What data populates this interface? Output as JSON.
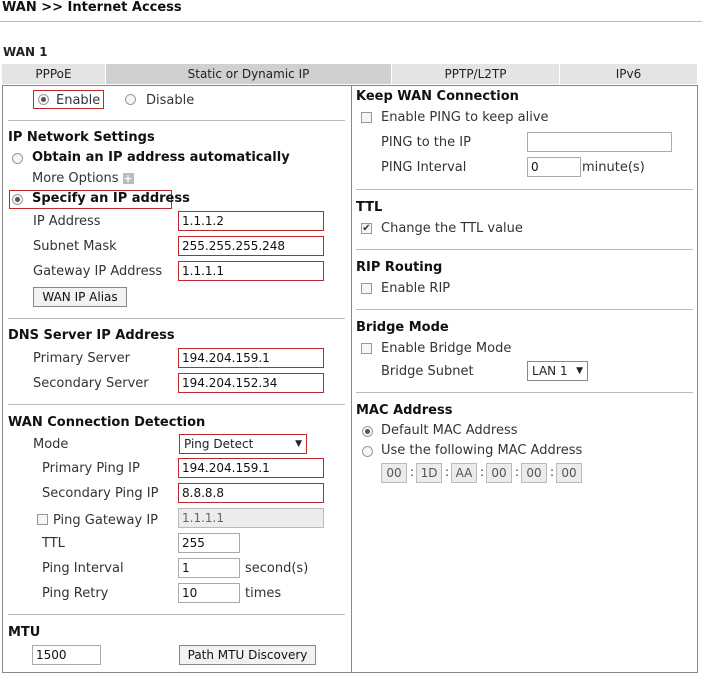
{
  "breadcrumb": "WAN >> Internet Access",
  "wan_title": "WAN 1",
  "tabs": [
    "PPPoE",
    "Static or Dynamic IP",
    "PPTP/L2TP",
    "IPv6"
  ],
  "enable": {
    "enable_label": "Enable",
    "disable_label": "Disable"
  },
  "ip_settings": {
    "title": "IP Network Settings",
    "obtain_auto": "Obtain an IP address automatically",
    "more_options": "More Options",
    "specify": "Specify an IP address",
    "ip_label": "IP Address",
    "ip_value": "1.1.1.2",
    "mask_label": "Subnet Mask",
    "mask_value": "255.255.255.248",
    "gw_label": "Gateway IP Address",
    "gw_value": "1.1.1.1",
    "alias_button": "WAN IP Alias"
  },
  "dns": {
    "title": "DNS Server IP Address",
    "primary_label": "Primary Server",
    "primary_value": "194.204.159.1",
    "secondary_label": "Secondary Server",
    "secondary_value": "194.204.152.34"
  },
  "detection": {
    "title": "WAN Connection Detection",
    "mode_label": "Mode",
    "mode_value": "Ping Detect",
    "primary_ping_label": "Primary Ping IP",
    "primary_ping_value": "194.204.159.1",
    "secondary_ping_label": "Secondary Ping IP",
    "secondary_ping_value": "8.8.8.8",
    "ping_gw_label": "Ping Gateway IP",
    "ping_gw_value": "1.1.1.1",
    "ttl_label": "TTL",
    "ttl_value": "255",
    "interval_label": "Ping Interval",
    "interval_value": "1",
    "interval_unit": "second(s)",
    "retry_label": "Ping Retry",
    "retry_value": "10",
    "retry_unit": "times"
  },
  "mtu": {
    "title": "MTU",
    "value": "1500",
    "discovery_button": "Path MTU Discovery"
  },
  "keep": {
    "title": "Keep WAN Connection",
    "enable_ping": "Enable PING to keep alive",
    "ping_ip_label": "PING to the IP",
    "ping_ip_value": "",
    "interval_label": "PING Interval",
    "interval_value": "0",
    "interval_unit": "minute(s)"
  },
  "ttl": {
    "title": "TTL",
    "change": "Change the TTL value"
  },
  "rip": {
    "title": "RIP Routing",
    "enable": "Enable RIP"
  },
  "bridge": {
    "title": "Bridge Mode",
    "enable": "Enable Bridge Mode",
    "subnet_label": "Bridge Subnet",
    "subnet_value": "LAN 1"
  },
  "mac": {
    "title": "MAC Address",
    "default": "Default MAC Address",
    "use_following": "Use the following MAC Address",
    "octets": [
      "00",
      "1D",
      "AA",
      "00",
      "00",
      "00"
    ],
    "separator": ":"
  }
}
